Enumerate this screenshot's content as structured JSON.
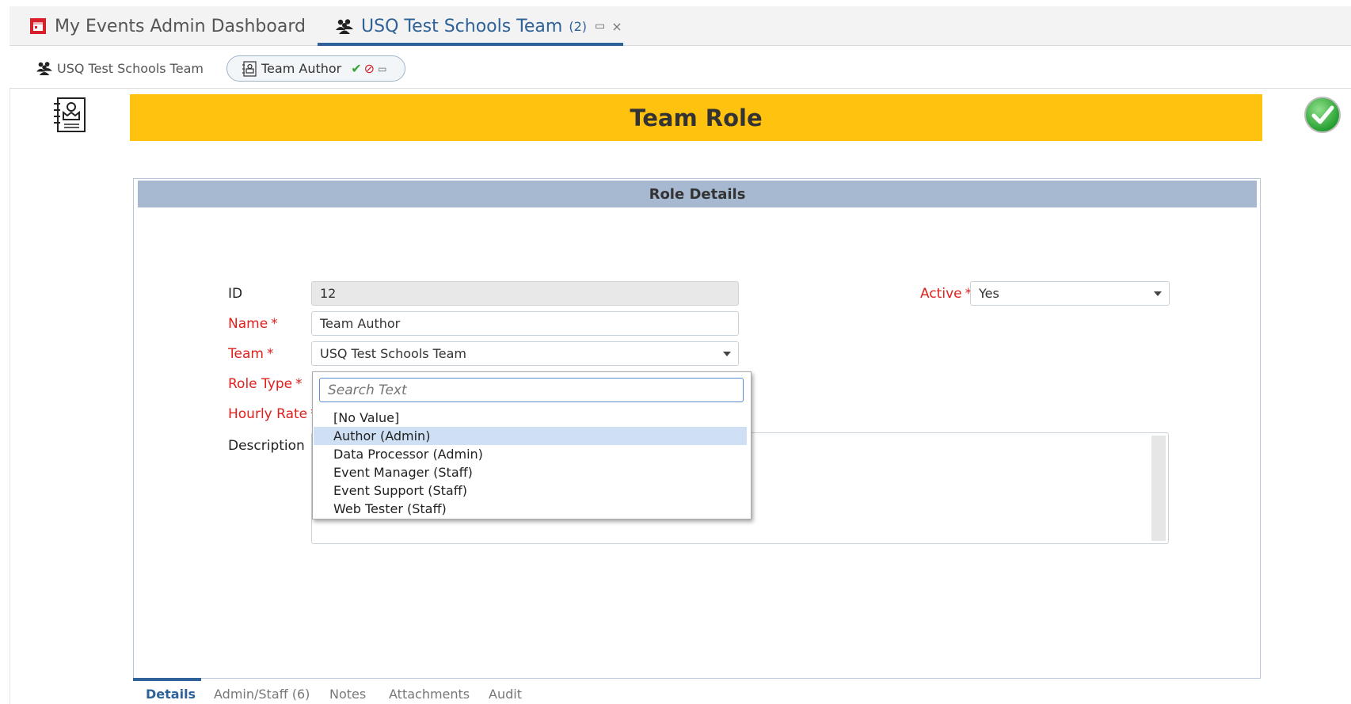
{
  "top_tabs": [
    {
      "label": "My Events Admin Dashboard",
      "icon": "calendar-icon"
    },
    {
      "label": "USQ Test Schools Team",
      "count": "(2)",
      "icon": "group-icon",
      "popout": "▭",
      "close": "×"
    }
  ],
  "breadcrumb": {
    "team": "USQ Test Schools Team",
    "role": "Team Author",
    "ok_glyph": "✔",
    "stop_glyph": "⊘",
    "pop_glyph": "▭"
  },
  "header": {
    "title": "Team Role",
    "icon": "role-card-icon",
    "action_icon": "green-check-icon"
  },
  "panel": {
    "title": "Role Details"
  },
  "form": {
    "id_label": "ID",
    "id_value": "12",
    "name_label": "Name",
    "name_value": "Team Author",
    "team_label": "Team",
    "team_value": "USQ Test Schools Team",
    "role_type_label": "Role Type",
    "hourly_rate_label": "Hourly Rate",
    "description_label": "Description",
    "active_label": "Active",
    "active_value": "Yes",
    "required_marker": "*"
  },
  "role_type_dropdown": {
    "placeholder": "Search Text",
    "options": [
      "[No Value]",
      "Author (Admin)",
      "Data Processor (Admin)",
      "Event Manager (Staff)",
      "Event Support (Staff)",
      "Web Tester (Staff)"
    ],
    "highlighted": "Author (Admin)"
  },
  "bottom_tabs": [
    {
      "label": "Details",
      "active": true
    },
    {
      "label": "Admin/Staff (6)"
    },
    {
      "label": "Notes"
    },
    {
      "label": "Attachments"
    },
    {
      "label": "Audit"
    }
  ],
  "colors": {
    "accent_blue": "#2e6299",
    "banner_yellow": "#ffc20e",
    "panel_header": "#a7b9d1",
    "required_red": "#e0201d",
    "selected_option": "#cfe0f5"
  }
}
